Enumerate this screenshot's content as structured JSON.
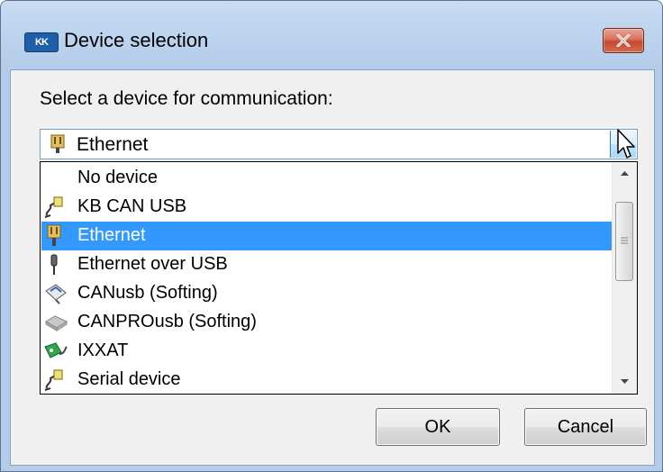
{
  "window": {
    "title": "Device selection",
    "app_icon_text": "KK"
  },
  "prompt": "Select a device for communication:",
  "combo": {
    "selected": "Ethernet",
    "selected_icon": "ethernet-plug-icon"
  },
  "devices": [
    {
      "label": "No device",
      "icon": "none",
      "selected": false
    },
    {
      "label": "KB CAN USB",
      "icon": "serial-cable-icon",
      "selected": false
    },
    {
      "label": "Ethernet",
      "icon": "ethernet-plug-icon",
      "selected": true
    },
    {
      "label": "Ethernet over USB",
      "icon": "usb-plug-icon",
      "selected": false
    },
    {
      "label": "CANusb (Softing)",
      "icon": "usb-stick-icon",
      "selected": false
    },
    {
      "label": "CANPROusb (Softing)",
      "icon": "usb-stick-grey-icon",
      "selected": false
    },
    {
      "label": "IXXAT",
      "icon": "ixxat-adapter-icon",
      "selected": false
    },
    {
      "label": "Serial device",
      "icon": "serial-cable-icon",
      "selected": false
    }
  ],
  "buttons": {
    "ok": "OK",
    "cancel": "Cancel"
  },
  "colors": {
    "selection": "#3399ff",
    "close_button": "#c44a2f",
    "window_frame": "#b4cce9"
  }
}
